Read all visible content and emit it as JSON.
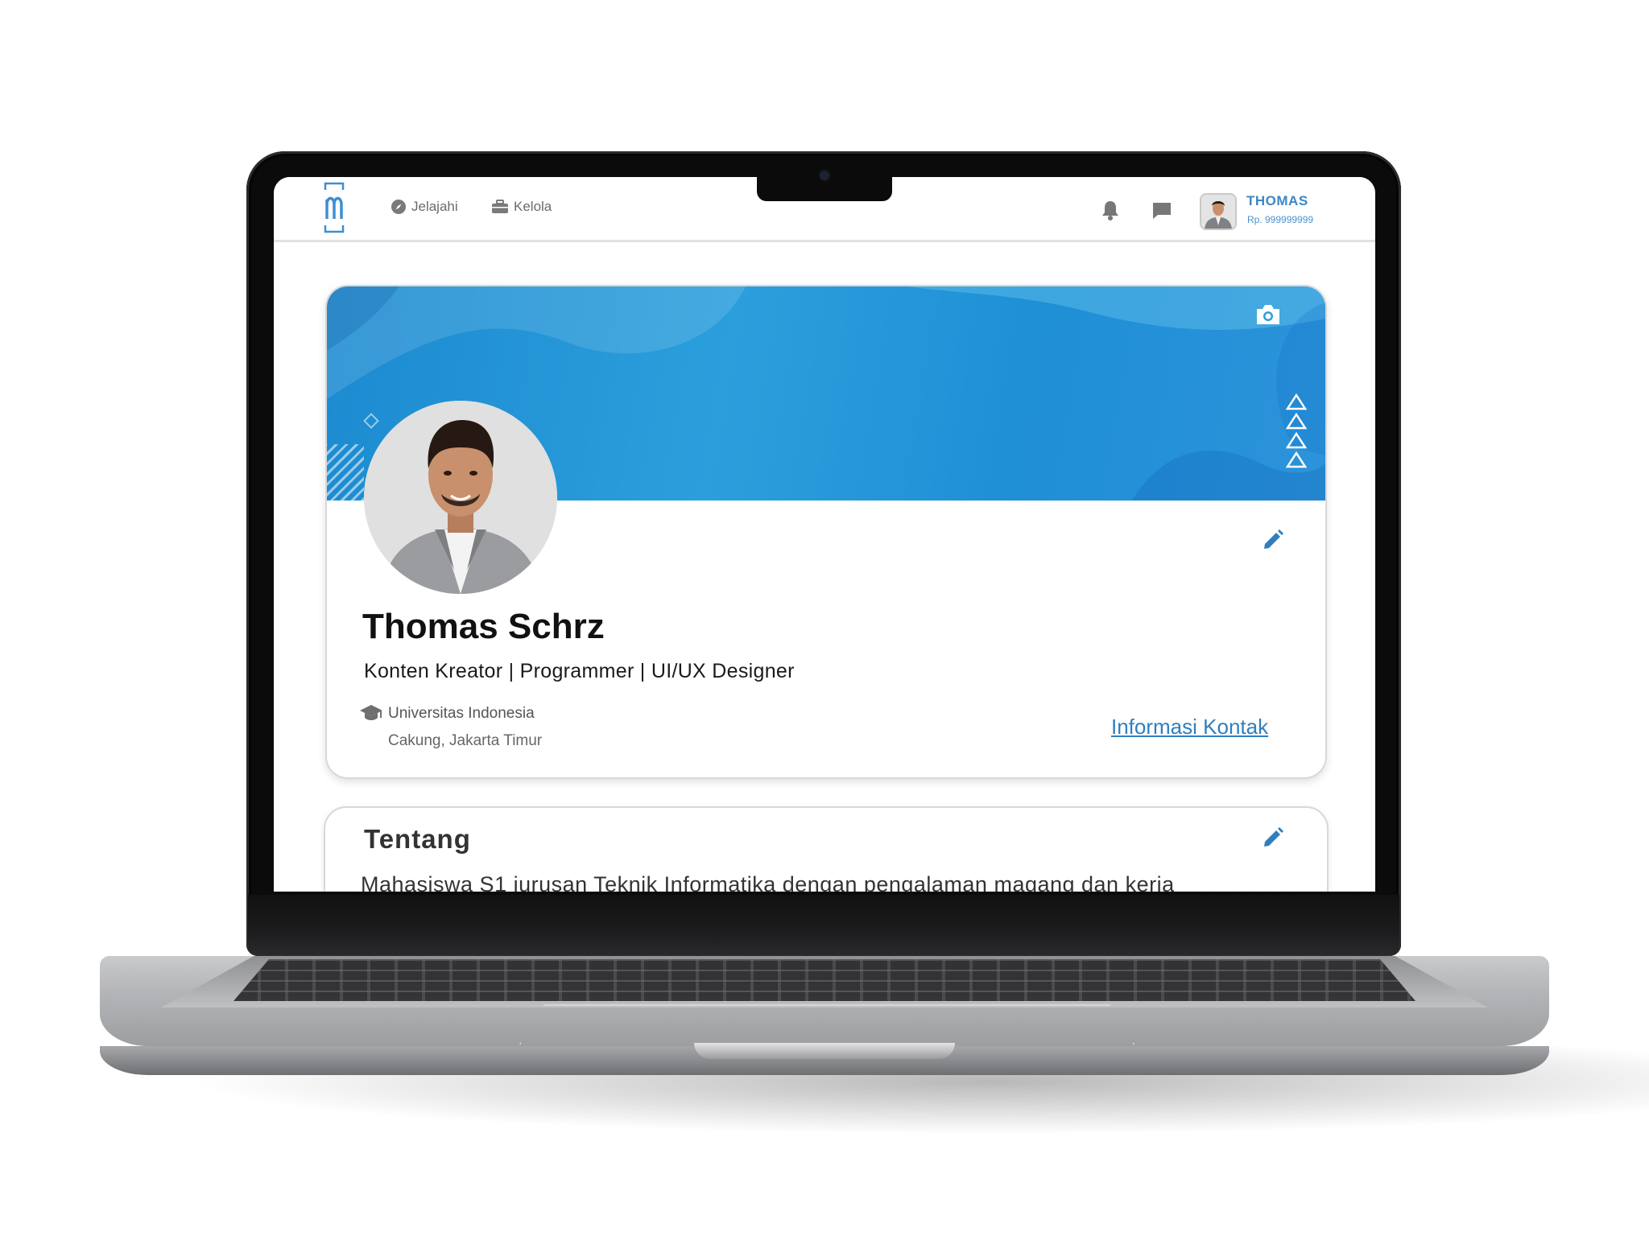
{
  "nav": {
    "items": [
      {
        "label": "Jelajahi",
        "icon": "compass-icon"
      },
      {
        "label": "Kelola",
        "icon": "briefcase-icon"
      }
    ],
    "user_name": "THOMAS",
    "balance": "Rp. 999999999"
  },
  "profile": {
    "name": "Thomas Schrz",
    "headline": "Konten Kreator | Programmer | UI/UX Designer",
    "school": "Universitas Indonesia",
    "location": "Cakung, Jakarta Timur",
    "contact_link": "Informasi Kontak"
  },
  "about": {
    "title": "Tentang",
    "text": "Mahasiswa S1 jurusan Teknik Informatika dengan pengalaman magang dan kerja"
  },
  "colors": {
    "accent": "#2f7fbf",
    "banner": "#1f8fd6"
  }
}
